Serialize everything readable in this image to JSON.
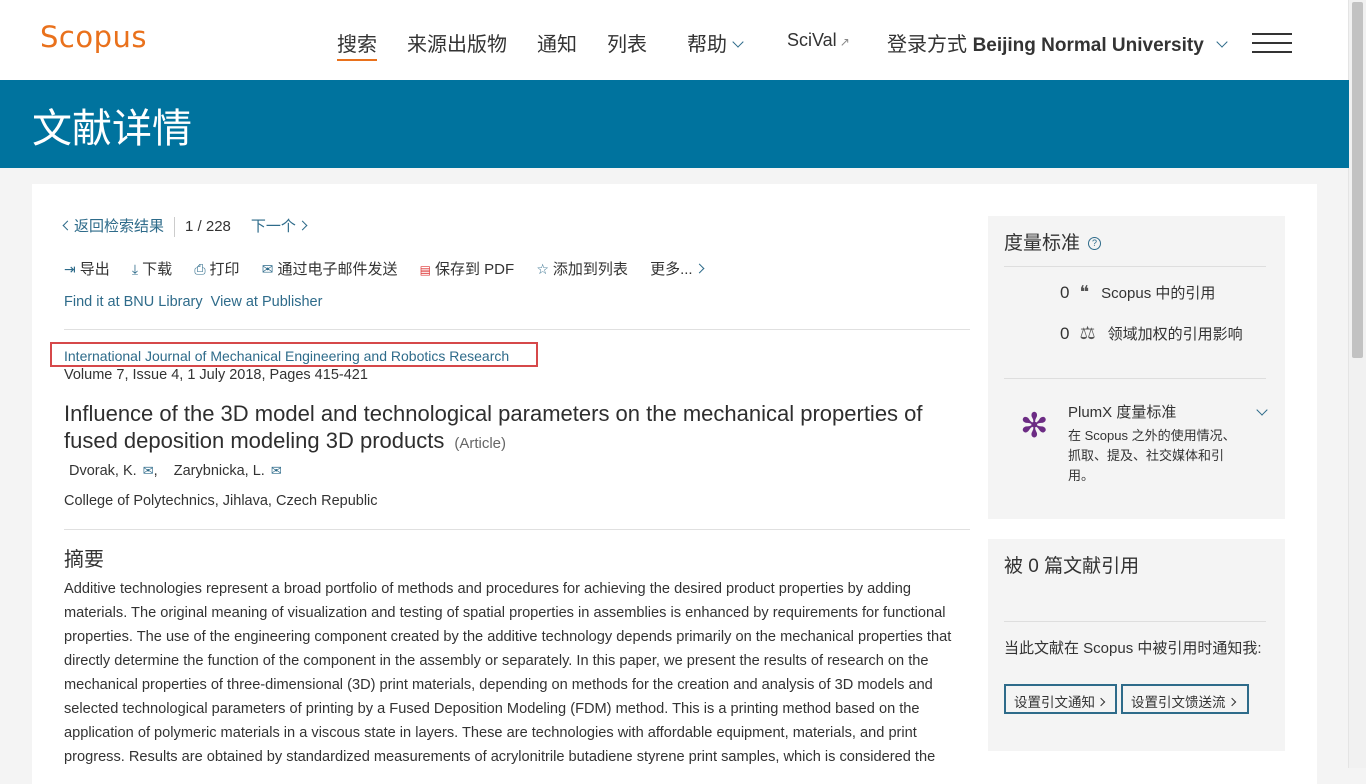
{
  "header": {
    "logo": "Scopus",
    "nav": [
      {
        "label": "搜索"
      },
      {
        "label": "来源出版物"
      },
      {
        "label": "通知"
      },
      {
        "label": "列表"
      },
      {
        "label": "帮助"
      },
      {
        "label": "SciVal"
      }
    ],
    "ext_glyph": "↗",
    "login_prefix": "登录方式",
    "login_org": "Beijing Normal University"
  },
  "banner": {
    "title": "文献详情"
  },
  "resultnav": {
    "back_label": "返回检索结果",
    "current": "1",
    "slash": "/",
    "total": "228",
    "next_label": "下一个"
  },
  "toolbar": {
    "export": "导出",
    "download": "下载",
    "print": "打印",
    "email": "通过电子邮件发送",
    "save_pdf": "保存到 PDF",
    "add_list": "添加到列表",
    "more": "更多..."
  },
  "links": {
    "library": "Find it at BNU Library",
    "publisher": "View at Publisher"
  },
  "document": {
    "journal": "International Journal of Mechanical Engineering and Robotics Research",
    "volume": "Volume 7, Issue 4, 1 July 2018, Pages 415-421",
    "title": "Influence of the 3D model and technological parameters on the mechanical properties of fused deposition modeling 3D products",
    "type": "(Article)",
    "authors": [
      {
        "name": "Dvorak, K.",
        "sep": ","
      },
      {
        "name": "Zarybnicka, L.",
        "sep": ""
      }
    ],
    "affiliation": "College of Polytechnics, Jihlava, Czech Republic",
    "abstract_heading": "摘要",
    "abstract": "Additive technologies represent a broad portfolio of methods and procedures for achieving the desired product properties by adding materials. The original meaning of visualization and testing of spatial properties in assemblies is enhanced by requirements for functional properties. The use of the engineering component created by the additive technology depends primarily on the mechanical properties that directly determine the function of the component in the assembly or separately. In this paper, we present the results of research on the mechanical properties of three-dimensional (3D) print materials, depending on methods for the creation and analysis of 3D models and selected technological parameters of printing by a Fused Deposition Modeling (FDM) method. This is a printing method based on the application of polymeric materials in a viscous state in layers. These are technologies with affordable equipment, materials, and print progress. Results are obtained by standardized measurements of acrylonitrile butadiene styrene print samples, which is considered the"
  },
  "metrics": {
    "heading": "度量标准",
    "help_glyph": "?",
    "citations_value": "0",
    "citations_label": "Scopus 中的引用",
    "fwci_value": "0",
    "fwci_label": "领域加权的引用影响",
    "plumx_title": "PlumX 度量标准",
    "plumx_desc": "在 Scopus 之外的使用情况、抓取、提及、社交媒体和引用。"
  },
  "cited": {
    "heading": "被 0 篇文献引用",
    "notify_text": "当此文献在 Scopus 中被引用时通知我:",
    "btn_alert": "设置引文通知",
    "btn_feed": "设置引文馈送流"
  }
}
